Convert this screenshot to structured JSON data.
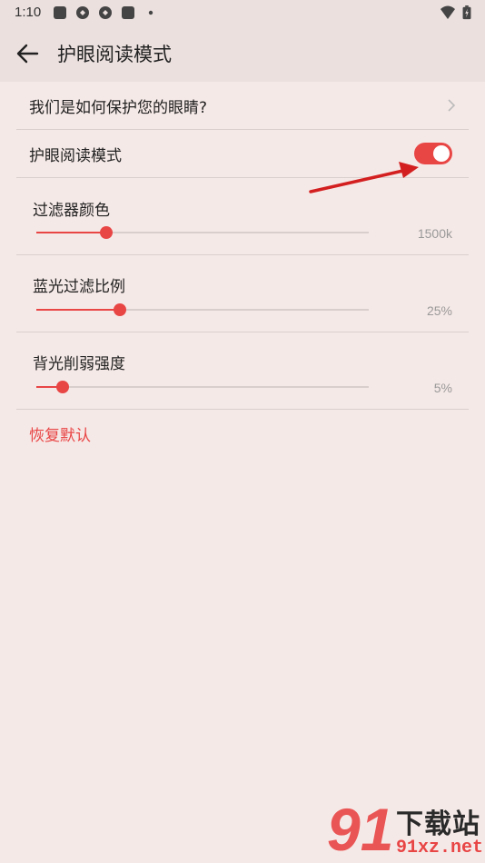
{
  "status_bar": {
    "time": "1:10",
    "left_icons": [
      "app-icon",
      "app-icon",
      "app-icon",
      "app-icon",
      "dot-icon"
    ],
    "right_icons": [
      "wifi-icon",
      "battery-icon"
    ]
  },
  "header": {
    "back_icon": "arrow-left-icon",
    "title": "护眼阅读模式"
  },
  "settings": {
    "protect_link": {
      "label": "我们是如何保护您的眼睛?",
      "icon": "chevron-right-icon"
    },
    "eye_mode": {
      "label": "护眼阅读模式",
      "enabled": true
    },
    "sliders": [
      {
        "label": "过滤器颜色",
        "value_text": "1500k",
        "level": 0.21
      },
      {
        "label": "蓝光过滤比例",
        "value_text": "25%",
        "level": 0.25
      },
      {
        "label": "背光削弱强度",
        "value_text": "5%",
        "level": 0.08
      }
    ],
    "reset_label": "恢复默认"
  },
  "watermark": {
    "logo_number": "91",
    "name": "下载站",
    "url": "91xz.net"
  },
  "colors": {
    "accent": "#e84545",
    "background": "#f5e9e7",
    "appbar": "#ebe0de",
    "divider": "#d9cfcd",
    "secondary_text": "#999999"
  }
}
